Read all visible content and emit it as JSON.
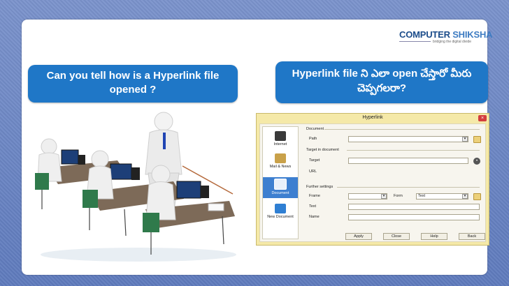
{
  "brand": {
    "name_part1": "COMPUTER",
    "name_part2": " SHIKSHA",
    "tagline": "bridging the digital divide"
  },
  "questions": {
    "english": "Can you tell how is a Hyperlink file opened ?",
    "telugu": "Hyperlink file ని ఎలా open చేస్తారో మీరు చెప్పగలరా?"
  },
  "dialog": {
    "title": "Hyperlink",
    "close": "×",
    "sidebar": [
      {
        "label": "Internet",
        "color": "#3a3a3a"
      },
      {
        "label": "Mail & News",
        "color": "#c9a14a"
      },
      {
        "label": "Document",
        "color": "#ffffff"
      },
      {
        "label": "New Document",
        "color": "#2f7fd3"
      }
    ],
    "selected_sidebar": "Document",
    "document_section": "Document",
    "path_label": "Path",
    "path_value": "",
    "target_section": "Target in document",
    "target_label": "Target",
    "target_value": "",
    "url_label": "URL",
    "further_section": "Further settings",
    "frame_label": "Frame",
    "frame_value": "",
    "form_label": "Form",
    "form_value": "Text",
    "text_label": "Text",
    "text_value": "",
    "name_label": "Name",
    "name_value": "",
    "buttons": {
      "apply": "Apply",
      "close": "Close",
      "help": "Help",
      "back": "Back"
    }
  }
}
